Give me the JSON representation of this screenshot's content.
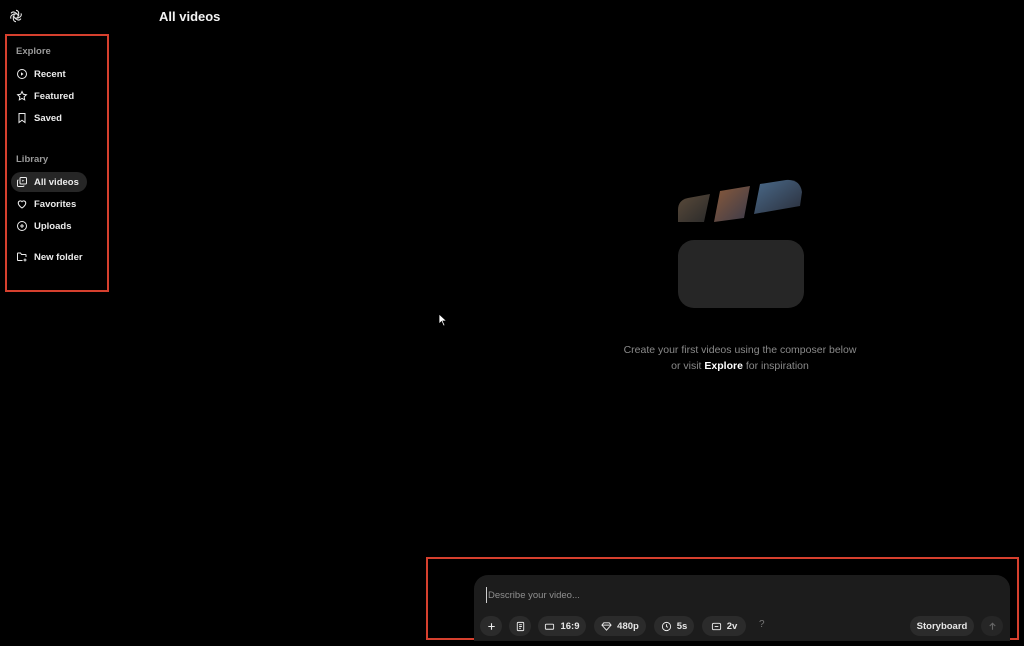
{
  "header": {
    "title": "All videos",
    "logo": "openai-logo-icon"
  },
  "sidebar": {
    "explore_label": "Explore",
    "explore_items": [
      {
        "label": "Recent",
        "icon": "play-circle-icon"
      },
      {
        "label": "Featured",
        "icon": "star-icon"
      },
      {
        "label": "Saved",
        "icon": "bookmark-icon"
      }
    ],
    "library_label": "Library",
    "library_items": [
      {
        "label": "All videos",
        "icon": "video-stack-icon",
        "active": true
      },
      {
        "label": "Favorites",
        "icon": "heart-icon"
      },
      {
        "label": "Uploads",
        "icon": "plus-circle-icon"
      },
      {
        "label": "New folder",
        "icon": "new-folder-icon"
      }
    ]
  },
  "empty_state": {
    "line1": "Create your first videos using the composer below",
    "line2_prefix": "or visit ",
    "line2_link": "Explore",
    "line2_suffix": " for inspiration",
    "icon": "clapperboard-icon"
  },
  "composer": {
    "placeholder": "Describe your video...",
    "aspect_ratio": "16:9",
    "resolution": "480p",
    "duration": "5s",
    "variations": "2v",
    "help": "?",
    "storyboard_label": "Storyboard"
  },
  "colors": {
    "highlight_border": "#d6402e",
    "background": "#000000",
    "composer_bg": "#1c1c1c"
  }
}
